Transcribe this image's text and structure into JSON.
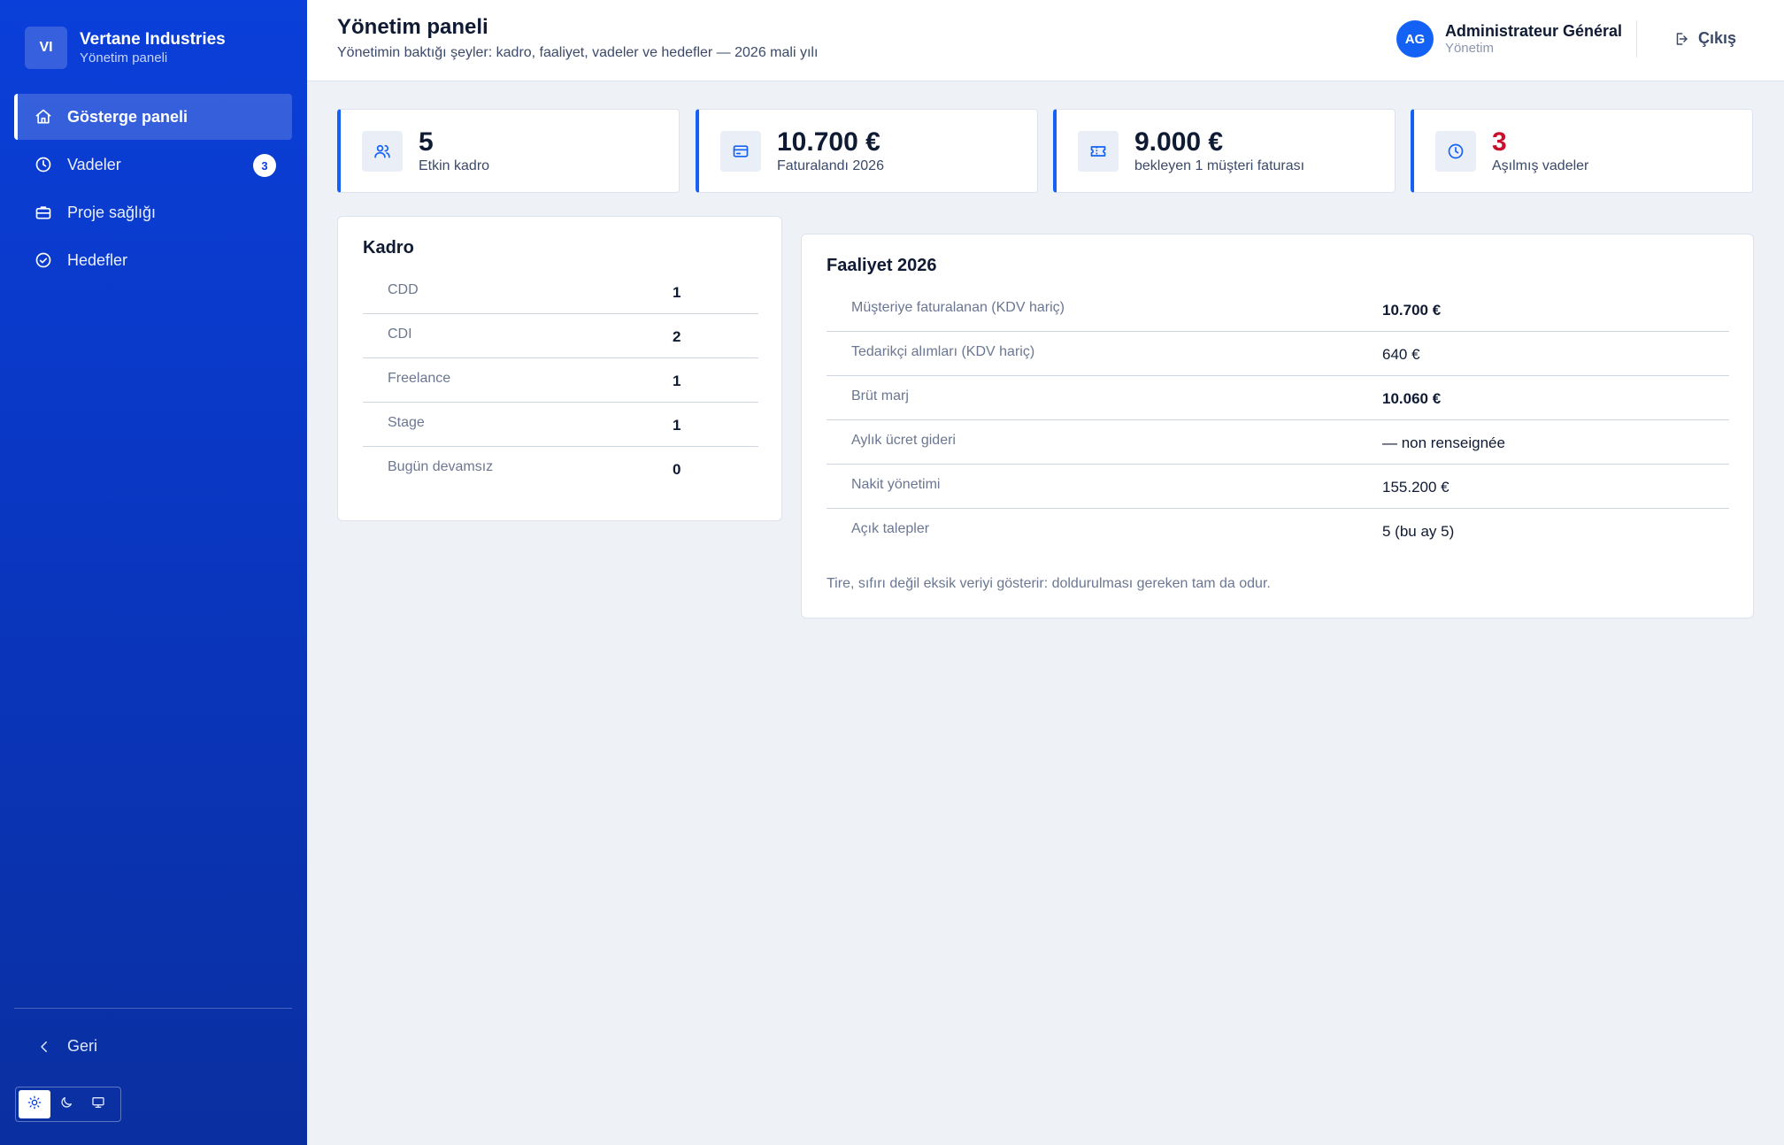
{
  "brand": {
    "initials": "VI",
    "name": "Vertane Industries",
    "subtitle": "Yönetim paneli"
  },
  "nav": {
    "items": [
      {
        "label": "Gösterge paneli",
        "icon": "home-icon",
        "active": true
      },
      {
        "label": "Vadeler",
        "icon": "clock-icon",
        "badge": "3"
      },
      {
        "label": "Proje sağlığı",
        "icon": "briefcase-icon"
      },
      {
        "label": "Hedefler",
        "icon": "check-circle-icon"
      }
    ],
    "back_label": "Geri"
  },
  "theme": {
    "options": [
      "sun-icon",
      "moon-icon",
      "monitor-icon"
    ],
    "selected": "sun-icon"
  },
  "header": {
    "title": "Yönetim paneli",
    "subtitle": "Yönetimin baktığı şeyler: kadro, faaliyet, vadeler ve hedefler — 2026 mali yılı",
    "user": {
      "initials": "AG",
      "name": "Administrateur Général",
      "role": "Yönetim"
    },
    "logout_label": "Çıkış"
  },
  "kpis": [
    {
      "value": "5",
      "label": "Etkin kadro",
      "icon": "users-icon"
    },
    {
      "value": "10.700 €",
      "label": "Faturalandı 2026",
      "icon": "credit-card-icon"
    },
    {
      "value": "9.000 €",
      "label": "bekleyen 1 müşteri faturası",
      "icon": "ticket-icon"
    },
    {
      "value": "3",
      "label": "Aşılmış vadeler",
      "icon": "clock-icon",
      "status": "danger"
    }
  ],
  "staff": {
    "title": "Kadro",
    "rows": [
      {
        "label": "CDD",
        "value": "1"
      },
      {
        "label": "CDI",
        "value": "2"
      },
      {
        "label": "Freelance",
        "value": "1"
      },
      {
        "label": "Stage",
        "value": "1"
      },
      {
        "label": "Bugün devamsız",
        "value": "0"
      }
    ]
  },
  "activity": {
    "title": "Faaliyet 2026",
    "rows": [
      {
        "label": "Müşteriye faturalanan (KDV hariç)",
        "value": "10.700 €",
        "bold": true
      },
      {
        "label": "Tedarikçi alımları (KDV hariç)",
        "value": "640 €",
        "bold": false
      },
      {
        "label": "Brüt marj",
        "value": "10.060 €",
        "bold": true
      },
      {
        "label": "Aylık ücret gideri",
        "value": "— non renseignée",
        "bold": false
      },
      {
        "label": "Nakit yönetimi",
        "value": "155.200 €",
        "bold": false
      },
      {
        "label": "Açık talepler",
        "value": "5 (bu ay 5)",
        "bold": false
      }
    ],
    "note": "Tire, sıfırı değil eksik veriyi gösterir: doldurulması gereken tam da odur."
  },
  "colors": {
    "accent": "#1462f5",
    "sidebar": "#0a3fd9",
    "danger": "#c8102e"
  }
}
